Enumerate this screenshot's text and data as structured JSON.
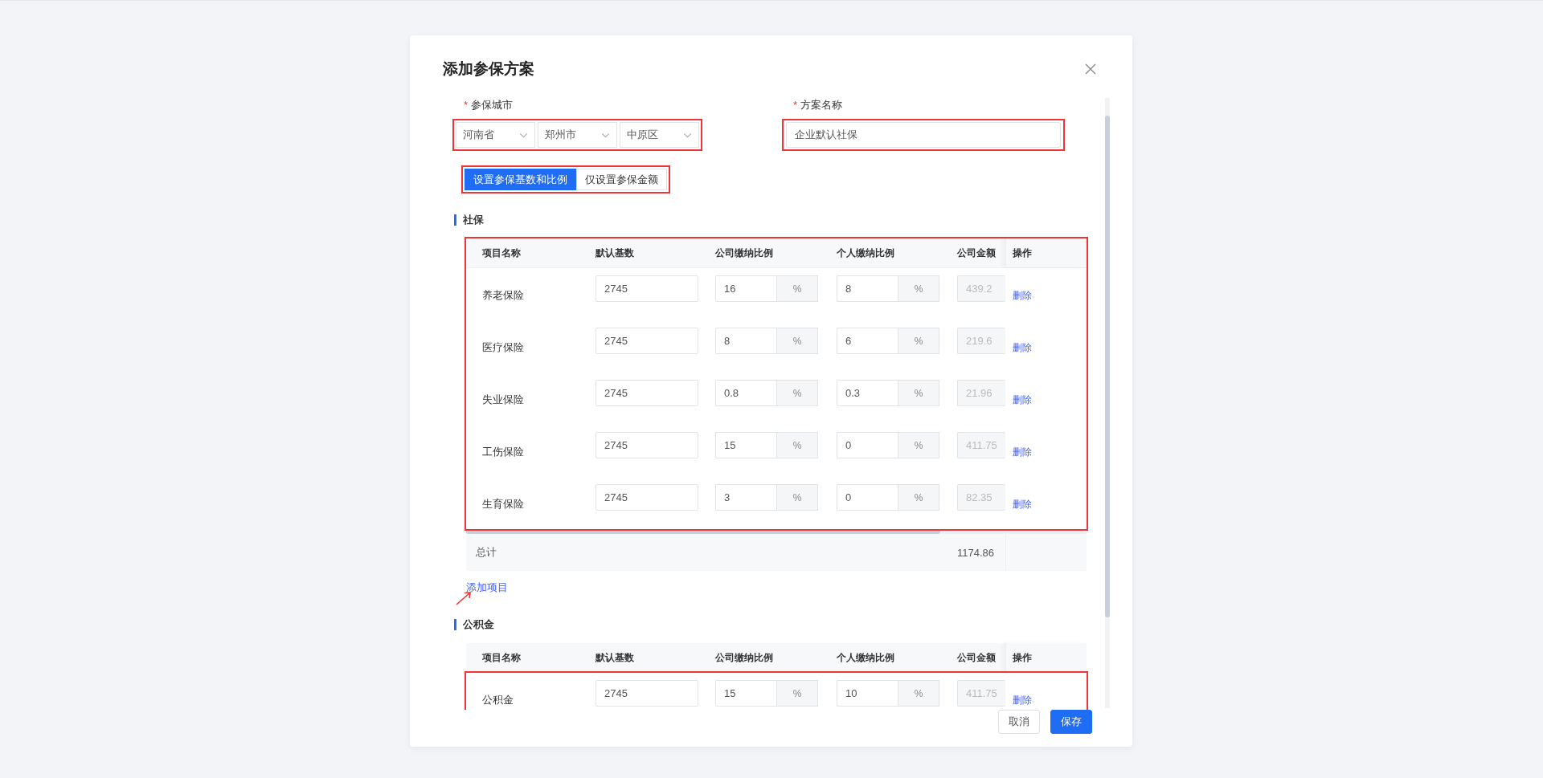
{
  "dialog": {
    "title": "添加参保方案"
  },
  "fields": {
    "city": {
      "label": "参保城市",
      "required_mark": "*",
      "selects": [
        "河南省",
        "郑州市",
        "中原区"
      ]
    },
    "name": {
      "label": "方案名称",
      "required_mark": "*",
      "value": "企业默认社保"
    }
  },
  "mode_tabs": [
    {
      "label": "设置参保基数和比例",
      "selected": true
    },
    {
      "label": "仅设置参保金额",
      "selected": false
    }
  ],
  "sections": [
    {
      "title": "社保",
      "columns": [
        "项目名称",
        "默认基数",
        "公司缴纳比例",
        "个人缴纳比例",
        "公司金额",
        "操作"
      ],
      "rows": [
        {
          "name": "养老保险",
          "base": "2745",
          "company_rate": "16",
          "company_unit": "%",
          "personal_rate": "8",
          "personal_unit": "%",
          "company_amount": "439.2",
          "action": "删除"
        },
        {
          "name": "医疗保险",
          "base": "2745",
          "company_rate": "8",
          "company_unit": "%",
          "personal_rate": "6",
          "personal_unit": "%",
          "company_amount": "219.6",
          "action": "删除"
        },
        {
          "name": "失业保险",
          "base": "2745",
          "company_rate": "0.8",
          "company_unit": "%",
          "personal_rate": "0.3",
          "personal_unit": "%",
          "company_amount": "21.96",
          "action": "删除"
        },
        {
          "name": "工伤保险",
          "base": "2745",
          "company_rate": "15",
          "company_unit": "%",
          "personal_rate": "0",
          "personal_unit": "%",
          "company_amount": "411.75",
          "action": "删除"
        },
        {
          "name": "生育保险",
          "base": "2745",
          "company_rate": "3",
          "company_unit": "%",
          "personal_rate": "0",
          "personal_unit": "%",
          "company_amount": "82.35",
          "action": "删除"
        }
      ],
      "total": {
        "label": "总计",
        "company_amount": "1174.86"
      },
      "add_link": "添加项目"
    },
    {
      "title": "公积金",
      "columns": [
        "项目名称",
        "默认基数",
        "公司缴纳比例",
        "个人缴纳比例",
        "公司金额",
        "操作"
      ],
      "rows": [
        {
          "name": "公积金",
          "base": "2745",
          "company_rate": "15",
          "company_unit": "%",
          "personal_rate": "10",
          "personal_unit": "%",
          "company_amount": "411.75",
          "action": "删除"
        }
      ]
    }
  ],
  "footer": {
    "buttons": [
      {
        "label": "取消",
        "kind": "default"
      },
      {
        "label": "保存",
        "kind": "primary"
      }
    ]
  }
}
